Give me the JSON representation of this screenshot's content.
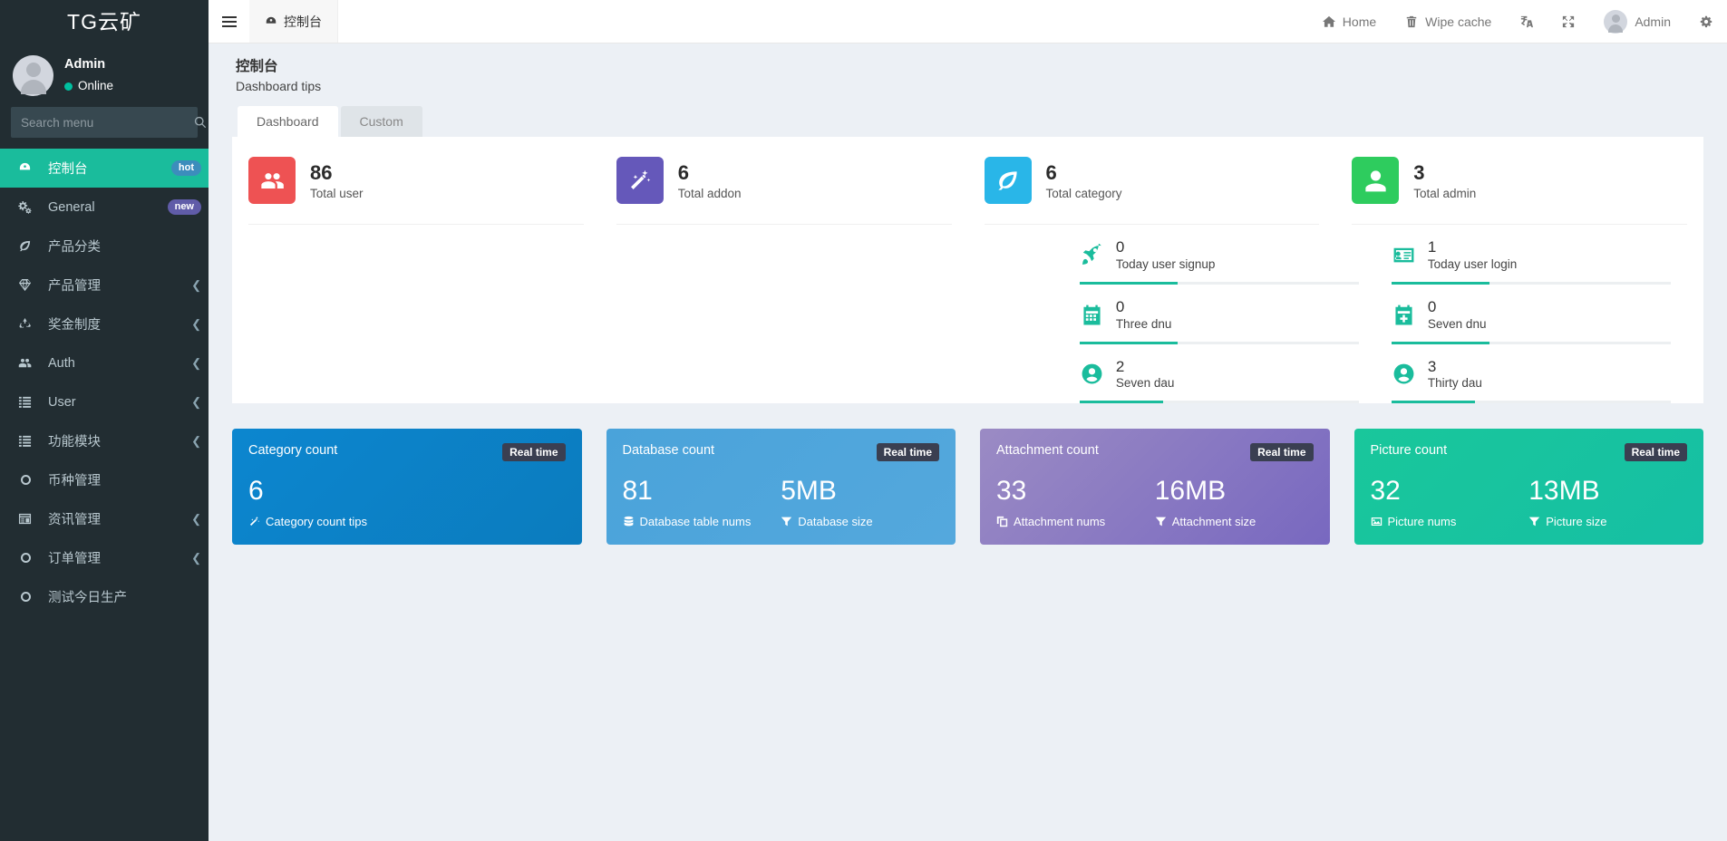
{
  "sidebar": {
    "brand": "TG云矿",
    "user": {
      "name": "Admin",
      "status": "Online"
    },
    "search": {
      "value": "",
      "placeholder": "Search menu"
    },
    "items": [
      {
        "label": "控制台",
        "icon": "dashboard-icon",
        "badge": "hot",
        "badge_type": "hot",
        "active": true,
        "arrow": false
      },
      {
        "label": "General",
        "icon": "gears-icon",
        "badge": "new",
        "badge_type": "new",
        "active": false,
        "arrow": false
      },
      {
        "label": "产品分类",
        "icon": "leaf-icon",
        "badge": "",
        "active": false,
        "arrow": false
      },
      {
        "label": "产品管理",
        "icon": "diamond-icon",
        "badge": "",
        "active": false,
        "arrow": true
      },
      {
        "label": "奖金制度",
        "icon": "recycle-icon",
        "badge": "",
        "active": false,
        "arrow": true
      },
      {
        "label": "Auth",
        "icon": "users-icon",
        "badge": "",
        "active": false,
        "arrow": true
      },
      {
        "label": "User",
        "icon": "list-icon",
        "badge": "",
        "active": false,
        "arrow": true
      },
      {
        "label": "功能模块",
        "icon": "list-icon",
        "badge": "",
        "active": false,
        "arrow": true
      },
      {
        "label": "币种管理",
        "icon": "circle-icon",
        "badge": "",
        "active": false,
        "arrow": false
      },
      {
        "label": "资讯管理",
        "icon": "window-icon",
        "badge": "",
        "active": false,
        "arrow": true
      },
      {
        "label": "订单管理",
        "icon": "circle-icon",
        "badge": "",
        "active": false,
        "arrow": true
      },
      {
        "label": "测试今日生产",
        "icon": "circle-icon",
        "badge": "",
        "active": false,
        "arrow": false
      }
    ]
  },
  "navbar": {
    "burger": "bars-icon",
    "tab_label": "控制台",
    "tab_icon": "dashboard-icon",
    "right_items": [
      {
        "label": "Home",
        "icon": "home-icon"
      },
      {
        "label": "Wipe cache",
        "icon": "trash-icon"
      },
      {
        "label": "",
        "icon": "language-icon"
      },
      {
        "label": "",
        "icon": "fullscreen-icon"
      },
      {
        "label": "Admin",
        "icon": "avatar"
      },
      {
        "label": "",
        "icon": "gear-icon"
      }
    ]
  },
  "page": {
    "title": "控制台",
    "subtitle": "Dashboard tips",
    "tabs": [
      {
        "label": "Dashboard",
        "active": true
      },
      {
        "label": "Custom",
        "active": false
      }
    ]
  },
  "stats": [
    {
      "value": "86",
      "label": "Total user",
      "icon": "users-icon",
      "color": "#ee5253"
    },
    {
      "value": "6",
      "label": "Total addon",
      "icon": "magic-icon",
      "color": "#6558ba"
    },
    {
      "value": "6",
      "label": "Total category",
      "icon": "leaf-icon",
      "color": "#29b6e8"
    },
    {
      "value": "3",
      "label": "Total admin",
      "icon": "user-icon",
      "color": "#2ecc5e"
    }
  ],
  "mini_stats": [
    {
      "value": "0",
      "label": "Today user signup",
      "icon": "rocket-icon",
      "progress": 35
    },
    {
      "value": "1",
      "label": "Today user login",
      "icon": "id-card-icon",
      "progress": 35
    },
    {
      "value": "0",
      "label": "Three dnu",
      "icon": "calendar-icon",
      "progress": 35
    },
    {
      "value": "0",
      "label": "Seven dnu",
      "icon": "calendar-plus-icon",
      "progress": 35
    },
    {
      "value": "2",
      "label": "Seven dau",
      "icon": "user-circle-icon",
      "progress": 30
    },
    {
      "value": "3",
      "label": "Thirty dau",
      "icon": "user-circle-icon",
      "progress": 30
    }
  ],
  "gradient_cards": [
    {
      "title": "Category count",
      "badge": "Real time",
      "color_from": "#0c86cf",
      "color_to": "#0b7cbe",
      "metrics": [
        {
          "value": "6",
          "label": "Category count tips",
          "icon": "magic-icon"
        }
      ]
    },
    {
      "title": "Database count",
      "badge": "Real time",
      "color_from": "#4aa3da",
      "color_to": "#54a8dd",
      "metrics": [
        {
          "value": "81",
          "label": "Database table nums",
          "icon": "database-icon"
        },
        {
          "value": "5MB",
          "label": "Database size",
          "icon": "filter-icon"
        }
      ]
    },
    {
      "title": "Attachment count",
      "badge": "Real time",
      "color_from": "#9b8bc4",
      "color_to": "#7868c0",
      "metrics": [
        {
          "value": "33",
          "label": "Attachment nums",
          "icon": "clone-icon"
        },
        {
          "value": "16MB",
          "label": "Attachment size",
          "icon": "filter-icon"
        }
      ]
    },
    {
      "title": "Picture count",
      "badge": "Real time",
      "color_from": "#19c79b",
      "color_to": "#16bfa4",
      "metrics": [
        {
          "value": "32",
          "label": "Picture nums",
          "icon": "image-icon"
        },
        {
          "value": "13MB",
          "label": "Picture size",
          "icon": "filter-icon"
        }
      ]
    }
  ],
  "colors": {
    "sidebar_bg": "#222d32",
    "accent": "#1abc9c",
    "content_bg": "#ecf0f5"
  }
}
